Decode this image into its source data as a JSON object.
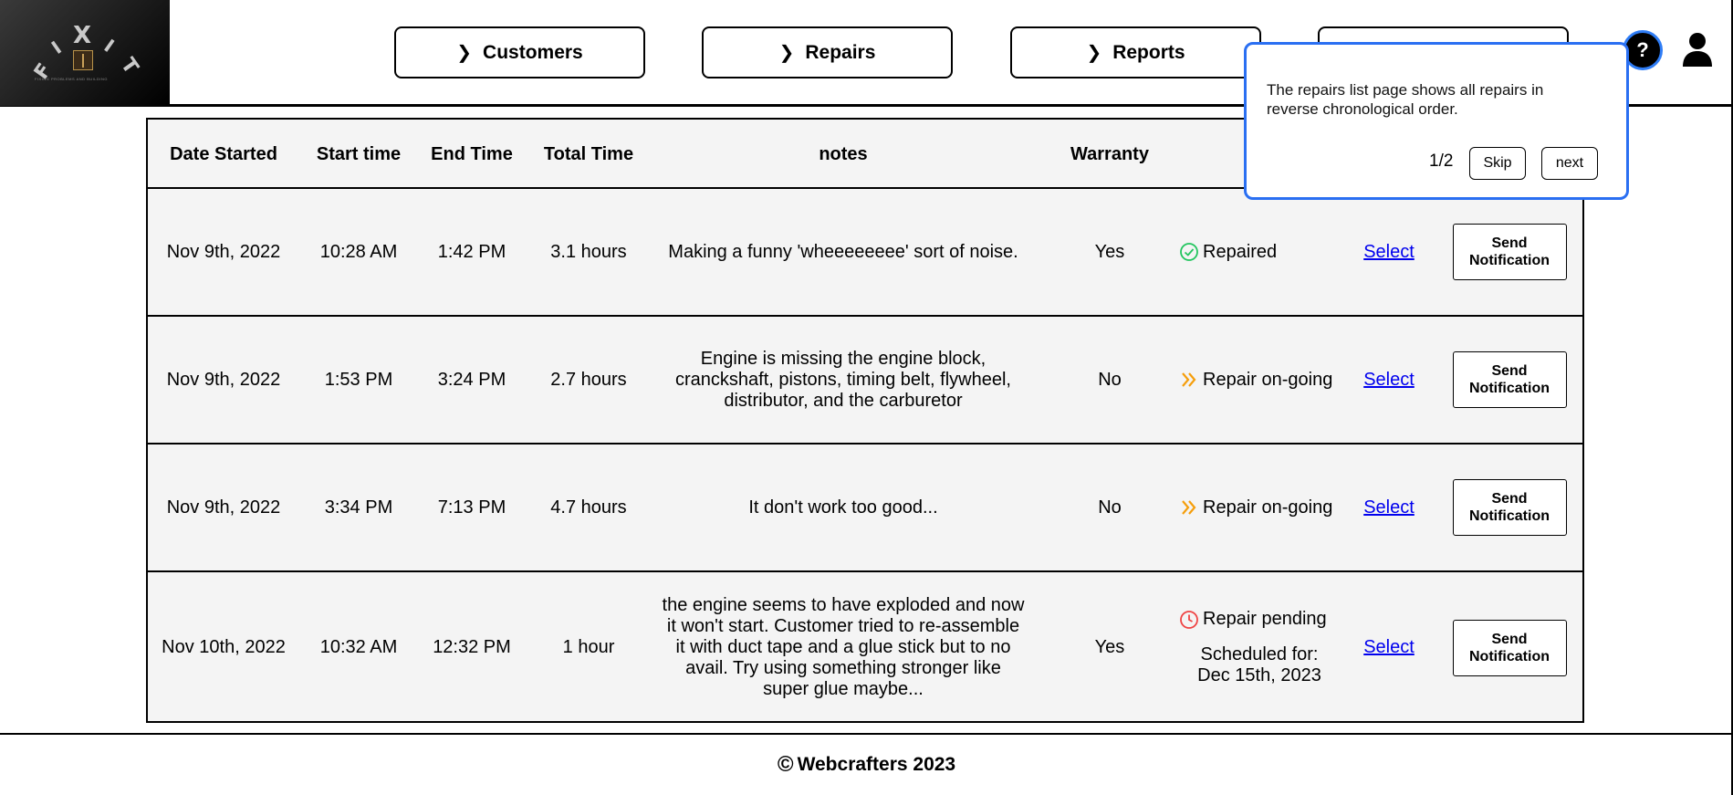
{
  "app": {
    "logo_letters": [
      "F",
      "I",
      "X",
      "I",
      "T"
    ],
    "logo_tagline": "FIXING PROBLEMS AND BUILDING"
  },
  "nav": {
    "customers": "Customers",
    "repairs": "Repairs",
    "reports": "Reports",
    "fourth": ""
  },
  "help": {
    "label": "?"
  },
  "tour": {
    "text": "The repairs list page shows all repairs in reverse chronological order.",
    "step": "1/2",
    "skip": "Skip",
    "next": "next"
  },
  "table": {
    "headers": [
      "Date Started",
      "Start time",
      "End Time",
      "Total Time",
      "notes",
      "Warranty"
    ],
    "rows": [
      {
        "date": "Nov 9th, 2022",
        "start": "10:28 AM",
        "end": "1:42 PM",
        "total": "3.1 hours",
        "notes": "Making a funny 'wheeeeeeee' sort of noise.",
        "warranty": "Yes",
        "status": "Repaired",
        "status_type": "repaired",
        "scheduled_label": "",
        "scheduled_date": "",
        "select": "Select",
        "notify": "Send Notification"
      },
      {
        "date": "Nov 9th, 2022",
        "start": "1:53 PM",
        "end": "3:24 PM",
        "total": "2.7 hours",
        "notes": "Engine is missing the engine block, cranckshaft, pistons, timing belt, flywheel, distributor, and the carburetor",
        "warranty": "No",
        "status": "Repair on-going",
        "status_type": "ongoing",
        "scheduled_label": "",
        "scheduled_date": "",
        "select": "Select",
        "notify": "Send Notification"
      },
      {
        "date": "Nov 9th, 2022",
        "start": "3:34 PM",
        "end": "7:13 PM",
        "total": "4.7 hours",
        "notes": "It don't work too good...",
        "warranty": "No",
        "status": "Repair on-going",
        "status_type": "ongoing",
        "scheduled_label": "",
        "scheduled_date": "",
        "select": "Select",
        "notify": "Send Notification"
      },
      {
        "date": "Nov 10th, 2022",
        "start": "10:32 AM",
        "end": "12:32 PM",
        "total": "1 hour",
        "notes": "the engine seems to have exploded and now it won't start. Customer tried to re-assemble it with duct tape and a glue stick but to no avail. Try using something stronger like super glue maybe...",
        "warranty": "Yes",
        "status": "Repair pending",
        "status_type": "pending",
        "scheduled_label": "Scheduled for:",
        "scheduled_date": "Dec 15th, 2023",
        "select": "Select",
        "notify": "Send Notification"
      }
    ]
  },
  "colors": {
    "repaired": "#22c55e",
    "ongoing": "#f59e0b",
    "pending": "#ef4444",
    "tour_border": "#2a6ff2",
    "link": "#0000ee"
  },
  "footer": {
    "text": "Webcrafters 2023",
    "symbol": "©"
  }
}
